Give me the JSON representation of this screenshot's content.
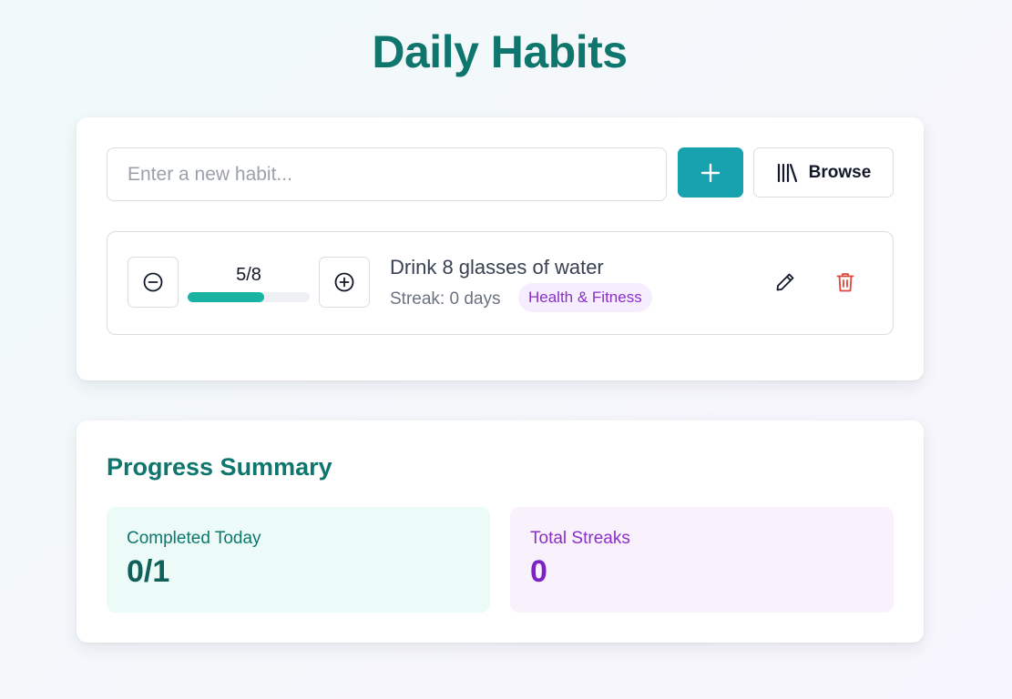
{
  "page": {
    "title": "Daily Habits"
  },
  "habit_form": {
    "input_value": "",
    "input_placeholder": "Enter a new habit...",
    "add_icon": "plus-icon",
    "browse_icon": "library-icon",
    "browse_label": "Browse"
  },
  "habits": [
    {
      "name": "Drink 8 glasses of water",
      "count_text": "5/8",
      "completed": 5,
      "target": 8,
      "progress_fraction": 0.625,
      "streak_text": "Streak: 0 days",
      "category": "Health & Fitness",
      "decrement_icon": "minus-circle-icon",
      "increment_icon": "plus-circle-icon",
      "edit_icon": "pencil-icon",
      "delete_icon": "trash-icon"
    }
  ],
  "summary": {
    "title": "Progress Summary",
    "completed_label": "Completed Today",
    "completed_value": "0/1",
    "streaks_label": "Total Streaks",
    "streaks_value": "0"
  },
  "colors": {
    "brand_teal": "#0f766e",
    "accent_button": "#18a1ae",
    "progress_fill": "#19b3a3",
    "category_purple": "#8b2fc9",
    "delete_red": "#e0453a"
  }
}
